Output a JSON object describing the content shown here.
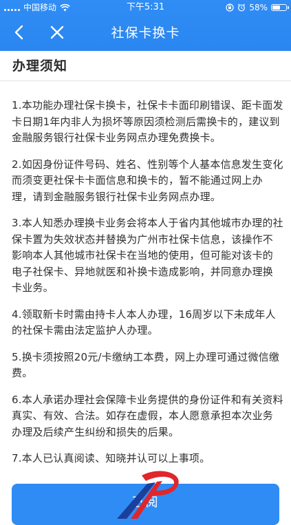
{
  "status_bar": {
    "carrier": "中国移动",
    "time": "下午5:31",
    "battery_text": "58%",
    "battery_level": 0.58
  },
  "nav": {
    "title": "社保卡换卡"
  },
  "notice": {
    "title": "办理须知",
    "items": [
      "1.本功能办理社保卡换卡，社保卡卡面印刷错误、距卡面发卡日期1年内非人为损坏等原因须检测后需换卡的，建议到金融服务银行社保卡业务网点办理免费换卡。",
      "2.如因身份证件号码、姓名、性别等个人基本信息发生变化而须变更社保卡卡面信息和换卡的，暂不能通过网上办理，请到金融服务银行社保卡业务网点办理。",
      "3.本人知悉办理换卡业务会将本人于省内其他城市办理的社保卡置为失效状态并替换为广州市社保卡信息，该操作不影响本人其他城市社保卡在当地的使用，但可能对该卡的电子社保卡、异地就医和补换卡造成影响，并同意办理换卡业务。",
      "4.领取新卡时需由持卡人本人办理，16周岁以下未成年人的社保卡需由法定监护人办理。",
      "5.换卡须按照20元/卡缴纳工本费，网上办理可通过微信缴费。",
      "6.本人承诺办理社会保障卡业务提供的身份证件和有关资料真实、有效、合法。如存在虚假，本人愿意承担本次业务办理及后续产生纠纷和损失的后果。",
      "7.本人已认真阅读、知晓并认可以上事项。"
    ]
  },
  "confirm_button": {
    "label": "已阅"
  },
  "colors": {
    "primary": "#2f8cf4",
    "text": "#2f2f2f",
    "divider": "#e3e3e3",
    "watermark_red": "#e0262b",
    "watermark_blue": "#1c3f9a"
  }
}
